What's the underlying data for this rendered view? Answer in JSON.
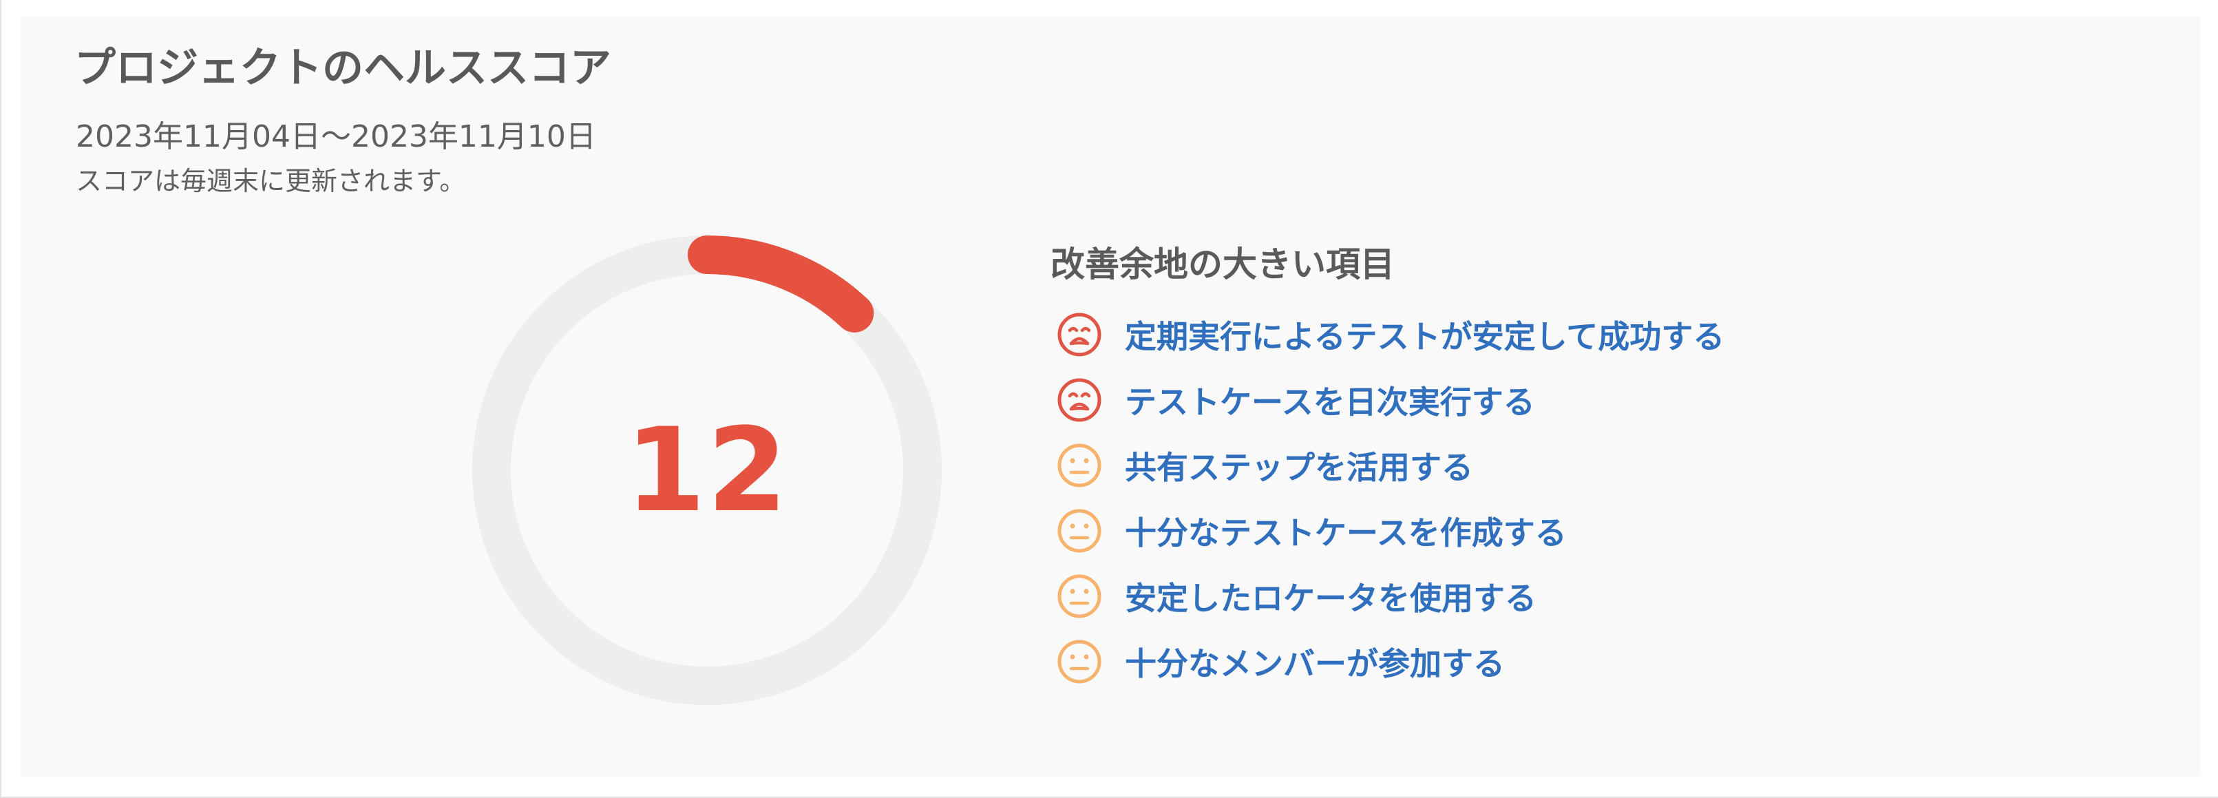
{
  "panel": {
    "title": "プロジェクトのヘルススコア",
    "period": "2023年11月04日～2023年11月10日",
    "note": "スコアは毎週末に更新されます。"
  },
  "score": {
    "value": "12",
    "max": 100,
    "color": "#e55240",
    "track_color": "#eeeeee"
  },
  "improvements": {
    "heading": "改善余地の大きい項目",
    "link_color": "#2f6fbd",
    "items": [
      {
        "label": "定期実行によるテストが安定して成功する",
        "status": "bad",
        "icon": "sad-face-icon"
      },
      {
        "label": "テストケースを日次実行する",
        "status": "bad",
        "icon": "sad-face-icon"
      },
      {
        "label": "共有ステップを活用する",
        "status": "neutral",
        "icon": "neutral-face-icon"
      },
      {
        "label": "十分なテストケースを作成する",
        "status": "neutral",
        "icon": "neutral-face-icon"
      },
      {
        "label": "安定したロケータを使用する",
        "status": "neutral",
        "icon": "neutral-face-icon"
      },
      {
        "label": "十分なメンバーが参加する",
        "status": "neutral",
        "icon": "neutral-face-icon"
      }
    ],
    "status_colors": {
      "bad": "#e05545",
      "neutral": "#f7b26b"
    }
  }
}
